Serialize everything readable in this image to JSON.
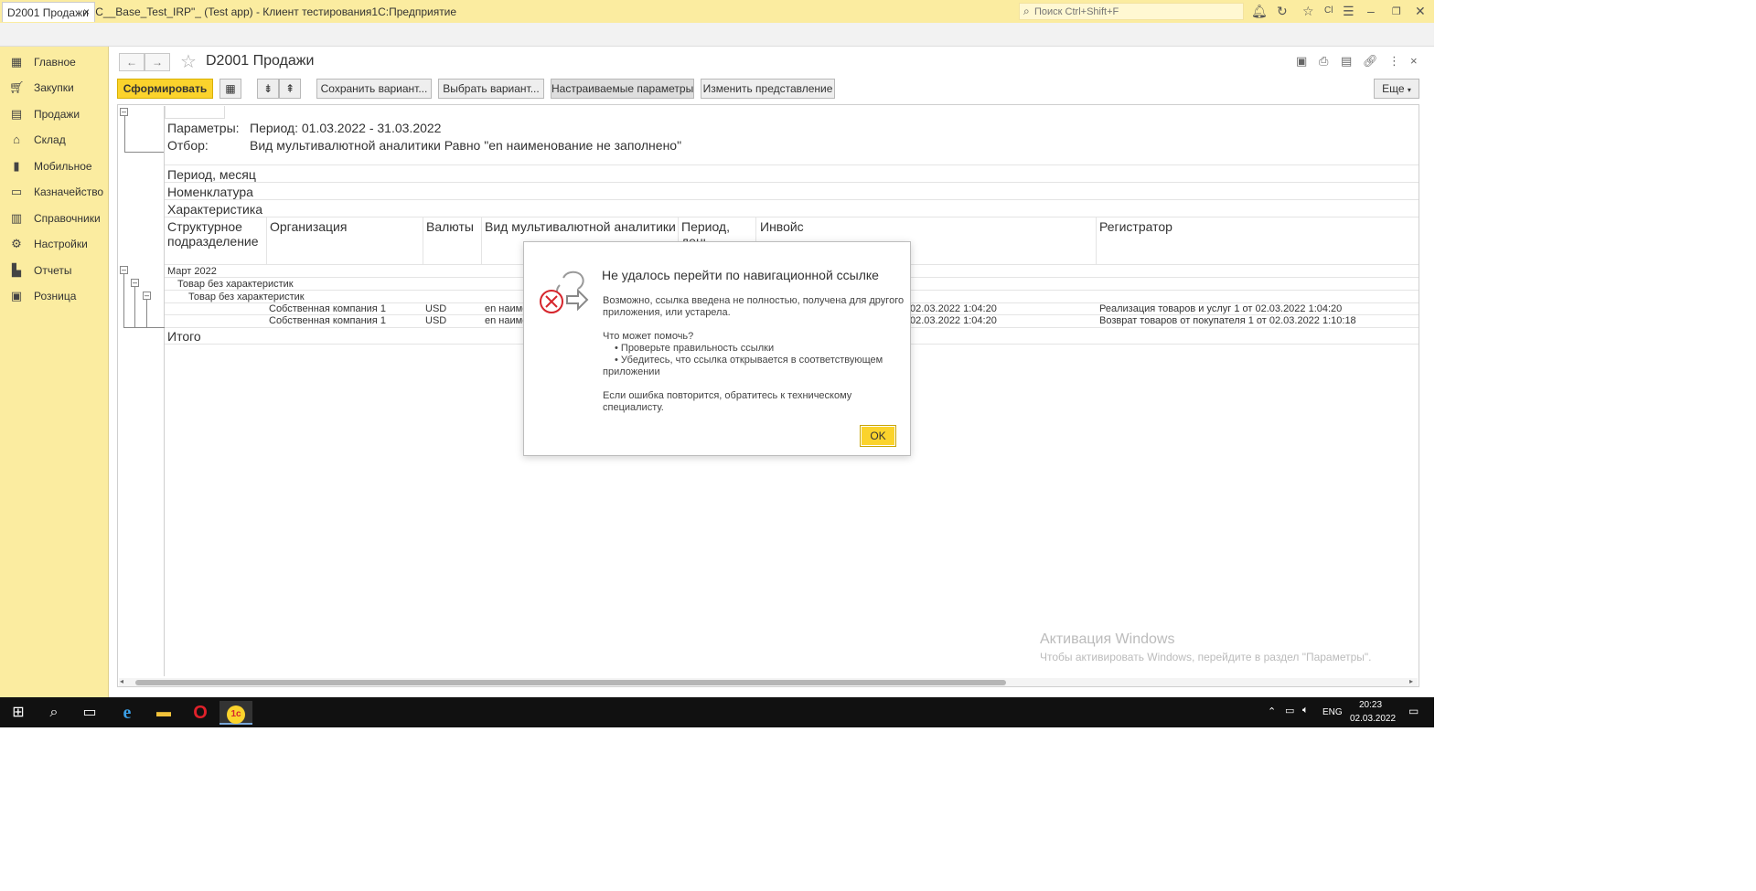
{
  "titlebar": {
    "logo": "1С",
    "title": "File_\"C__Base_Test_IRP\"_ (Test app)  - Клиент тестирования1С:Предприятие",
    "search_placeholder": "Поиск Ctrl+Shift+F",
    "user_initials": "Cl"
  },
  "tabs": [
    {
      "label": "D2001 Продажи",
      "close": "×"
    }
  ],
  "sidebar": {
    "items": [
      {
        "label": "Главное"
      },
      {
        "label": "Закупки"
      },
      {
        "label": "Продажи"
      },
      {
        "label": "Склад"
      },
      {
        "label": "Мобильное"
      },
      {
        "label": "Казначейство"
      },
      {
        "label": "Справочники"
      },
      {
        "label": "Настройки"
      },
      {
        "label": "Отчеты"
      },
      {
        "label": "Розница"
      }
    ]
  },
  "page": {
    "title": "D2001 Продажи",
    "toolbar": {
      "generate": "Сформировать",
      "save_variant": "Сохранить вариант...",
      "select_variant": "Выбрать вариант...",
      "custom_params": "Настраиваемые параметры",
      "change_view": "Изменить представление",
      "more": "Еще"
    }
  },
  "report": {
    "params_label": "Параметры:",
    "params_value": "Период: 01.03.2022 - 31.03.2022",
    "filter_label": "Отбор:",
    "filter_value": "Вид мультивалютной аналитики Равно \"en наименование не заполнено\"",
    "grouping": [
      "Период, месяц",
      "Номенклатура",
      "Характеристика"
    ],
    "columns": [
      "Структурное подразделение",
      "Организация",
      "Валюты",
      "Вид мультивалютной аналитики",
      "Период, день",
      "Инвойс",
      "Регистратор"
    ],
    "column_lines": [
      [
        "Структурное",
        "подразделение"
      ],
      [
        "Организация"
      ],
      [
        "Валюты"
      ],
      [
        "Вид мультивалютной аналитики"
      ],
      [
        "Период,",
        "день"
      ],
      [
        "Инвойс"
      ],
      [
        "Регистратор"
      ]
    ],
    "group_month": "Март 2022",
    "group_item": "Товар без характеристик",
    "group_char": "Товар без характеристик",
    "rows": [
      {
        "org": "Собственная компания 1",
        "currency": "USD",
        "analytics": "en наиме",
        "date": "02.03.2022 1:04:20",
        "registrar": "Реализация товаров и услуг 1 от 02.03.2022 1:04:20"
      },
      {
        "org": "Собственная компания 1",
        "currency": "USD",
        "analytics": "en наиме",
        "date": "02.03.2022 1:04:20",
        "registrar": "Возврат товаров от покупателя 1 от 02.03.2022 1:10:18"
      }
    ],
    "total": "Итого"
  },
  "dialog": {
    "title": "Не удалось перейти по навигационной ссылке",
    "line1": "Возможно, ссылка введена не полностью, получена для другого",
    "line2": "приложения, или устарела.",
    "help_title": "Что может помочь?",
    "bullet1": "• Проверьте правильность ссылки",
    "bullet2": "• Убедитесь, что ссылка открывается в соответствующем",
    "bullet2b": "приложении",
    "footer1": "Если ошибка повторится, обратитесь к техническому",
    "footer2": "специалисту.",
    "ok": "OK"
  },
  "watermark": {
    "line1": "Активация Windows",
    "line2": "Чтобы активировать Windows, перейдите в раздел \"Параметры\"."
  },
  "taskbar": {
    "lang": "ENG",
    "time": "20:23",
    "date": "02.03.2022"
  },
  "colors": {
    "accent_yellow": "#fbd32c",
    "panel_yellow": "#fbeca0",
    "error_red": "#d6252c"
  }
}
